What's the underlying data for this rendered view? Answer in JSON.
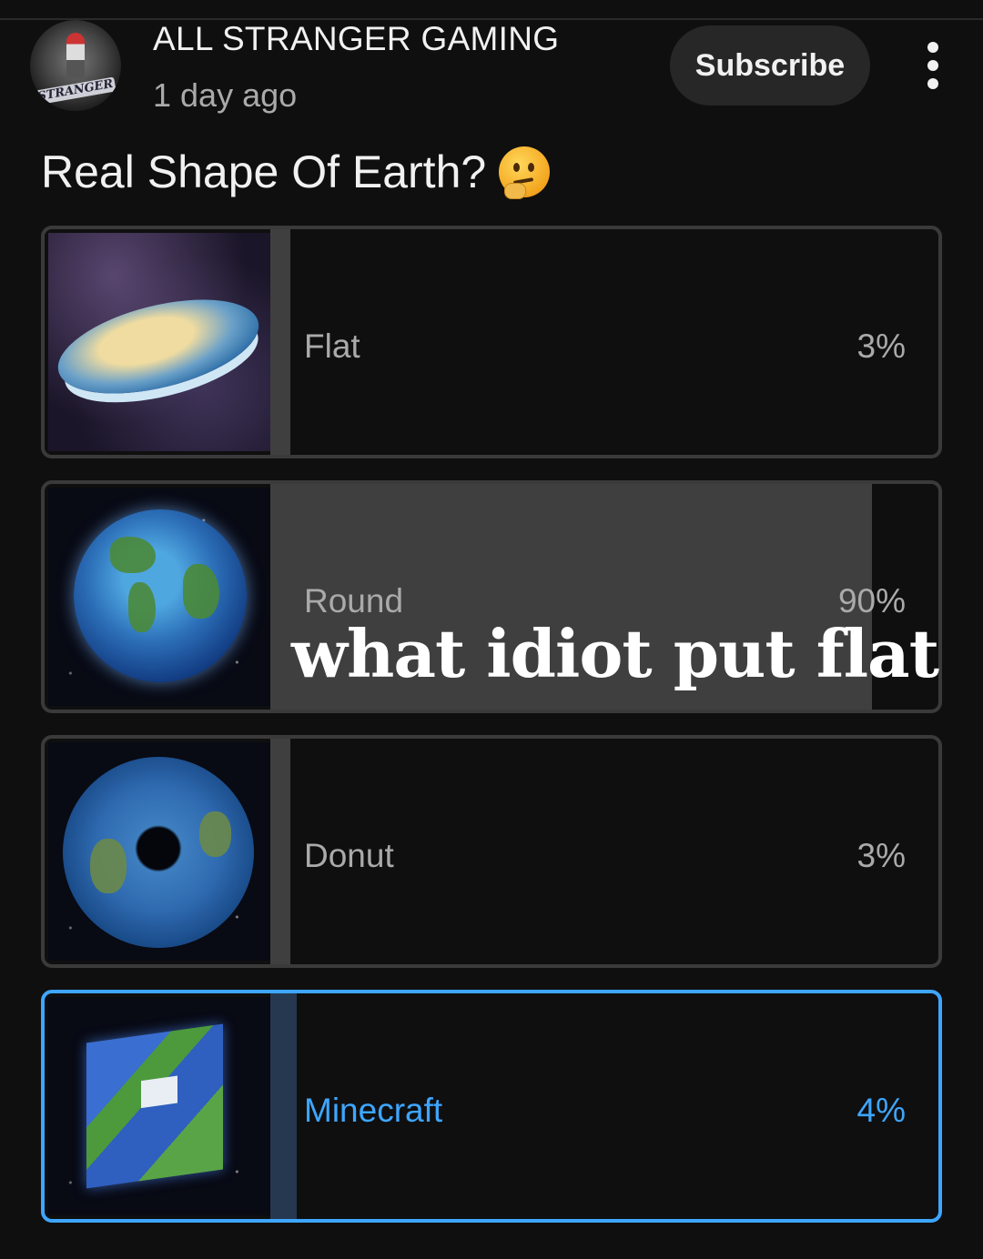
{
  "post": {
    "channel_name": "ALL STRANGER GAMING",
    "avatar_text": "STRANGER",
    "time": "1 day ago",
    "subscribe_label": "Subscribe",
    "question": "Real Shape Of Earth?",
    "question_emoji": "thinking-face"
  },
  "poll": {
    "options": [
      {
        "label": "Flat",
        "percent_text": "3%",
        "percent": 3,
        "selected": false,
        "image": "flat-earth-disc"
      },
      {
        "label": "Round",
        "percent_text": "90%",
        "percent": 90,
        "selected": false,
        "image": "round-earth-globe"
      },
      {
        "label": "Donut",
        "percent_text": "3%",
        "percent": 3,
        "selected": false,
        "image": "donut-earth"
      },
      {
        "label": "Minecraft",
        "percent_text": "4%",
        "percent": 4,
        "selected": true,
        "image": "minecraft-cube-earth"
      }
    ]
  },
  "overlay_caption": "what idiot put flat",
  "colors": {
    "background": "#0f0f0f",
    "bar_fill": "#3f3f3f",
    "selected_accent": "#3ea6ff",
    "selected_bar_fill": "#263850"
  }
}
